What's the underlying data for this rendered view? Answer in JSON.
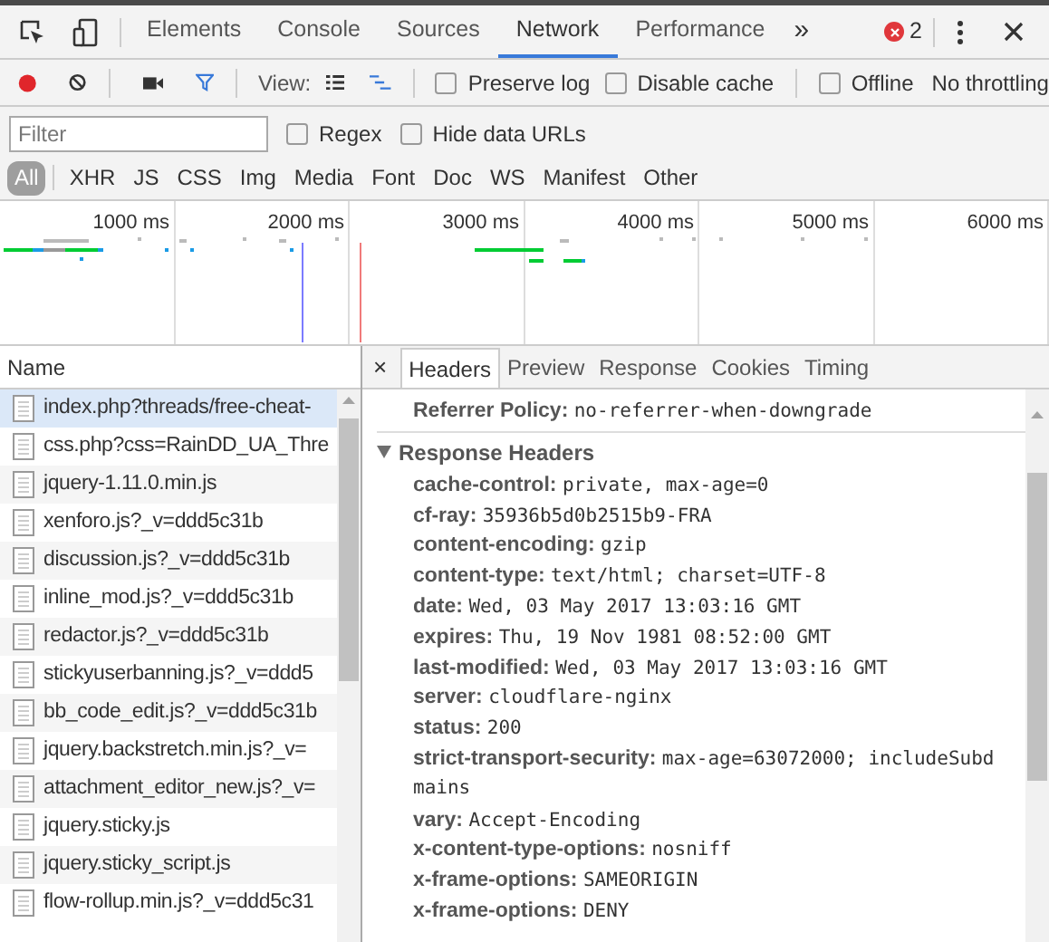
{
  "panel_tabs": [
    {
      "label": "Elements",
      "selected": false
    },
    {
      "label": "Console",
      "selected": false
    },
    {
      "label": "Sources",
      "selected": false
    },
    {
      "label": "Network",
      "selected": true
    },
    {
      "label": "Performance",
      "selected": false
    }
  ],
  "more_tabs": "»",
  "error_count": "2",
  "toolbar": {
    "view_label": "View:",
    "checkboxes": [
      {
        "label": "Preserve log",
        "checked": false
      },
      {
        "label": "Disable cache",
        "checked": false
      }
    ],
    "offline": {
      "label": "Offline",
      "checked": false
    },
    "throttling": "No throttling"
  },
  "filter": {
    "placeholder": "Filter",
    "checkboxes": [
      {
        "label": "Regex",
        "checked": false
      },
      {
        "label": "Hide data URLs",
        "checked": false
      }
    ]
  },
  "type_filters": [
    {
      "label": "All",
      "selected": true
    },
    {
      "label": "XHR",
      "selected": false
    },
    {
      "label": "JS",
      "selected": false
    },
    {
      "label": "CSS",
      "selected": false
    },
    {
      "label": "Img",
      "selected": false
    },
    {
      "label": "Media",
      "selected": false
    },
    {
      "label": "Font",
      "selected": false
    },
    {
      "label": "Doc",
      "selected": false
    },
    {
      "label": "WS",
      "selected": false
    },
    {
      "label": "Manifest",
      "selected": false
    },
    {
      "label": "Other",
      "selected": false
    }
  ],
  "timeline": {
    "ticks": [
      "1000 ms",
      "2000 ms",
      "3000 ms",
      "4000 ms",
      "5000 ms",
      "6000 ms"
    ]
  },
  "requests": {
    "column": "Name",
    "rows": [
      {
        "name": "index.php?threads/free-cheat-",
        "selected": true
      },
      {
        "name": "css.php?css=RainDD_UA_Thre",
        "selected": false
      },
      {
        "name": "jquery-1.11.0.min.js",
        "selected": false
      },
      {
        "name": "xenforo.js?_v=ddd5c31b",
        "selected": false
      },
      {
        "name": "discussion.js?_v=ddd5c31b",
        "selected": false
      },
      {
        "name": "inline_mod.js?_v=ddd5c31b",
        "selected": false
      },
      {
        "name": "redactor.js?_v=ddd5c31b",
        "selected": false
      },
      {
        "name": "stickyuserbanning.js?_v=ddd5",
        "selected": false
      },
      {
        "name": "bb_code_edit.js?_v=ddd5c31b",
        "selected": false
      },
      {
        "name": "jquery.backstretch.min.js?_v=",
        "selected": false
      },
      {
        "name": "attachment_editor_new.js?_v=",
        "selected": false
      },
      {
        "name": "jquery.sticky.js",
        "selected": false
      },
      {
        "name": "jquery.sticky_script.js",
        "selected": false
      },
      {
        "name": "flow-rollup.min.js?_v=ddd5c31",
        "selected": false
      }
    ]
  },
  "details": {
    "close": "×",
    "tabs": [
      {
        "label": "Headers",
        "selected": true
      },
      {
        "label": "Preview",
        "selected": false
      },
      {
        "label": "Response",
        "selected": false
      },
      {
        "label": "Cookies",
        "selected": false
      },
      {
        "label": "Timing",
        "selected": false
      }
    ],
    "referrer": {
      "key": "Referrer Policy:",
      "value": "no-referrer-when-downgrade"
    },
    "section": {
      "title": "Response Headers",
      "expanded": true
    },
    "headers": [
      {
        "key": "cache-control:",
        "value": "private, max-age=0"
      },
      {
        "key": "cf-ray:",
        "value": "35936b5d0b2515b9-FRA"
      },
      {
        "key": "content-encoding:",
        "value": "gzip"
      },
      {
        "key": "content-type:",
        "value": "text/html; charset=UTF-8"
      },
      {
        "key": "date:",
        "value": "Wed, 03 May 2017 13:03:16 GMT"
      },
      {
        "key": "expires:",
        "value": "Thu, 19 Nov 1981 08:52:00 GMT"
      },
      {
        "key": "last-modified:",
        "value": "Wed, 03 May 2017 13:03:16 GMT"
      },
      {
        "key": "server:",
        "value": "cloudflare-nginx"
      },
      {
        "key": "status:",
        "value": "200"
      },
      {
        "key": "strict-transport-security:",
        "value": "max-age=63072000; includeSubd",
        "continuation": "mains"
      },
      {
        "key": "vary:",
        "value": "Accept-Encoding"
      },
      {
        "key": "x-content-type-options:",
        "value": "nosniff"
      },
      {
        "key": "x-frame-options:",
        "value": "SAMEORIGIN"
      },
      {
        "key": "x-frame-options:",
        "value": "DENY"
      }
    ]
  }
}
